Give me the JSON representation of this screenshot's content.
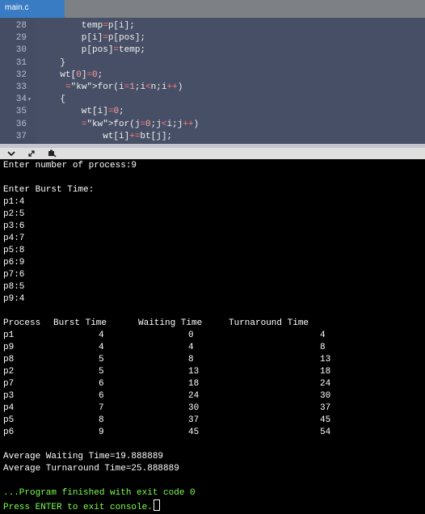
{
  "tab": {
    "label": "main.c"
  },
  "editor": {
    "lines": [
      {
        "num": "28",
        "fold": "",
        "code": "        temp=p[i];"
      },
      {
        "num": "29",
        "fold": "",
        "code": "        p[i]=p[pos];"
      },
      {
        "num": "30",
        "fold": "",
        "code": "        p[pos]=temp;"
      },
      {
        "num": "31",
        "fold": "",
        "code": "    }"
      },
      {
        "num": "32",
        "fold": "",
        "code": "    wt[0]=0;"
      },
      {
        "num": "33",
        "fold": "",
        "code": "     for(i=1;i<n;i++)"
      },
      {
        "num": "34",
        "fold": "▾",
        "code": "    {"
      },
      {
        "num": "35",
        "fold": "",
        "code": "        wt[i]=0;"
      },
      {
        "num": "36",
        "fold": "",
        "code": "        for(j=0;j<i;j++)"
      },
      {
        "num": "37",
        "fold": "",
        "code": "            wt[i]+=bt[j];"
      }
    ]
  },
  "toolbar": {
    "icons": [
      "chevron-down-icon",
      "expand-icon",
      "terminal-settings-icon"
    ]
  },
  "console": {
    "prompt_count": "Enter number of process:9",
    "prompt_burst": "Enter Burst Time:",
    "inputs": [
      "p1:4",
      "p2:5",
      "p3:6",
      "p4:7",
      "p5:8",
      "p6:9",
      "p7:6",
      "p8:5",
      "p9:4"
    ],
    "table": {
      "headers": [
        "Process",
        "Burst Time",
        "Waiting Time",
        "Turnaround Time"
      ],
      "rows": [
        [
          "p1",
          "4",
          "0",
          "4"
        ],
        [
          "p9",
          "4",
          "4",
          "8"
        ],
        [
          "p8",
          "5",
          "8",
          "13"
        ],
        [
          "p2",
          "5",
          "13",
          "18"
        ],
        [
          "p7",
          "6",
          "18",
          "24"
        ],
        [
          "p3",
          "6",
          "24",
          "30"
        ],
        [
          "p4",
          "7",
          "30",
          "37"
        ],
        [
          "p5",
          "8",
          "37",
          "45"
        ],
        [
          "p6",
          "9",
          "45",
          "54"
        ]
      ]
    },
    "avg_waiting": "Average Waiting Time=19.888889",
    "avg_turnaround": "Average Turnaround Time=25.888889",
    "exit_message": "...Program finished with exit code 0",
    "continue_message": "Press ENTER to exit console."
  }
}
